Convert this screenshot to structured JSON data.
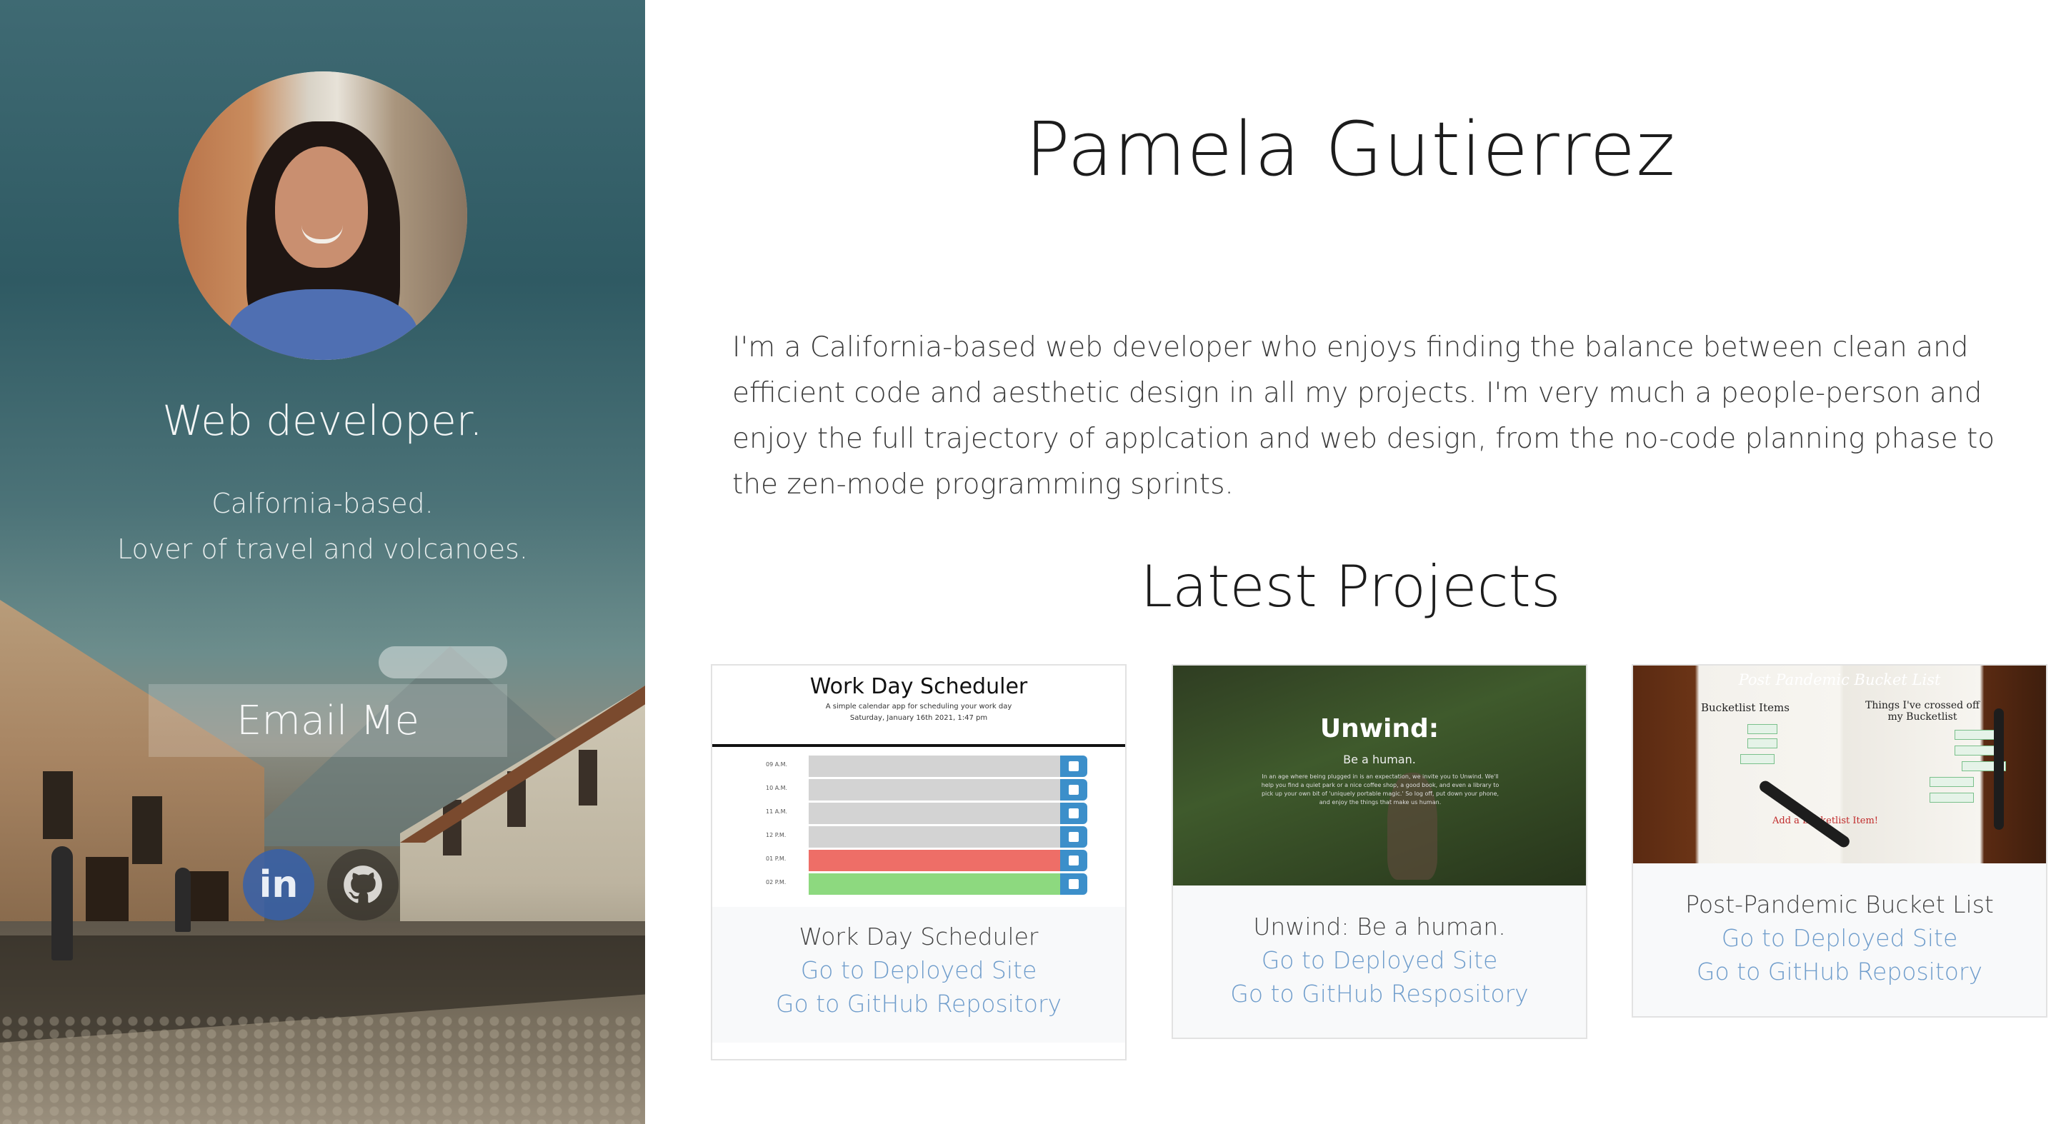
{
  "sidebar": {
    "tagline": "Web developer.",
    "line1": "Calfornia-based.",
    "line2": "Lover of travel and volcanoes.",
    "email_button": "Email Me",
    "social": [
      {
        "name": "linkedin-icon",
        "glyph": "in"
      },
      {
        "name": "github-icon",
        "glyph": "●"
      }
    ]
  },
  "main": {
    "name": "Pamela Gutierrez",
    "bio": "I'm a California-based web developer who enjoys finding the balance between clean and efficient code and aesthetic design in all my projects. I'm very much a people-person and enjoy the full trajectory of applcation and web design, from the no-code planning phase to the zen-mode programming sprints.",
    "projects_heading": "Latest Projects"
  },
  "projects": [
    {
      "title": "Work Day Scheduler",
      "deployed_link": "Go to Deployed Site",
      "repo_link": "Go to GitHub Repository",
      "thumb": {
        "title": "Work Day Scheduler",
        "subtitle": "A simple calendar app for scheduling your work day",
        "date": "Saturday, January 16th 2021, 1:47 pm",
        "hours": [
          "09 A.M.",
          "10 A.M.",
          "11 A.M.",
          "12 P.M.",
          "01 P.M.",
          "02 P.M."
        ]
      }
    },
    {
      "title": "Unwind: Be a human.",
      "deployed_link": "Go to Deployed Site",
      "repo_link": "Go to GitHub Respository",
      "thumb": {
        "title": "Unwind:",
        "subtitle": "Be a human.",
        "text": "In an age where being plugged in is an expectation, we invite you to Unwind. We'll help you find a quiet park or a nice coffee shop, a good book, and even a library to pick up your own bit of 'uniquely portable magic.' So log off, put down your phone, and enjoy the things that make us human."
      }
    },
    {
      "title": "Post-Pandemic Bucket List",
      "deployed_link": "Go to Deployed Site",
      "repo_link": "Go to GitHub Repository",
      "thumb": {
        "title": "Post Pandemic Bucket List",
        "left_heading": "Bucketlist Items",
        "right_heading": "Things I've crossed off my Bucketlist",
        "add_label": "Add a Bucketlist Item!"
      }
    }
  ],
  "colors": {
    "link": "#6e9ccb",
    "sidebar_teal": "#2f5a63",
    "save_blue": "#3c8fca",
    "past_gray": "#d3d3d3",
    "present_red": "#ee6e67",
    "future_green": "#8dd97f"
  }
}
